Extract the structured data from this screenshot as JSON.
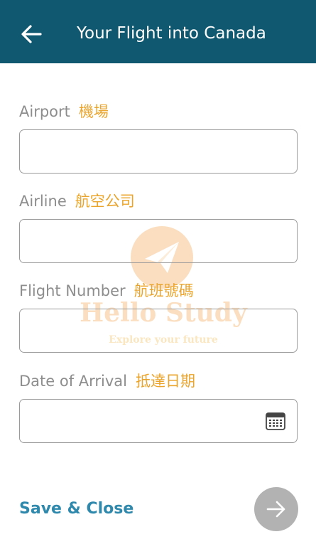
{
  "header": {
    "back_icon": "arrow-left-icon",
    "title": "Your Flight into Canada",
    "background_color": "#0f5870"
  },
  "form": {
    "fields": [
      {
        "label": "Airport",
        "label_zh": "機場",
        "value": ""
      },
      {
        "label": "Airline",
        "label_zh": "航空公司",
        "value": ""
      },
      {
        "label": "Flight Number",
        "label_zh": "航班號碼",
        "value": ""
      },
      {
        "label": "Date of Arrival",
        "label_zh": "抵達日期",
        "value": "",
        "icon": "calendar-icon"
      }
    ]
  },
  "watermark": {
    "title": "Hello Study",
    "subtitle": "Explore your future",
    "icon": "paper-plane-icon"
  },
  "footer": {
    "save_label": "Save & Close",
    "next_icon": "arrow-right-icon",
    "link_color": "#2f89ad",
    "accent_color": "#eba42b"
  }
}
